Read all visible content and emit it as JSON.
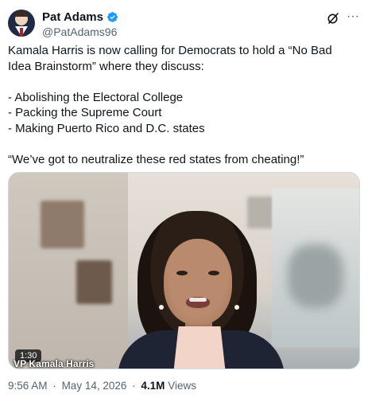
{
  "author": {
    "display_name": "Pat Adams",
    "handle": "@PatAdams96",
    "verified": true,
    "verified_color": "#1d9bf0"
  },
  "actions": {
    "grok_icon": "grok-slash-icon",
    "more_icon": "more-horizontal-icon",
    "more_glyph": "···"
  },
  "tweet": {
    "text": "Kamala Harris is now calling for Democrats to hold a “No Bad Idea Brainstorm” where they discuss:\n\n- Abolishing the Electoral College\n- Packing the Supreme Court\n- Making Puerto Rico and D.C. states\n\n“We’ve got to neutralize these red states from cheating!”"
  },
  "media": {
    "duration": "1:30",
    "caption": "VP Kamala Harris"
  },
  "meta": {
    "time": "9:56 AM",
    "date": "May 14, 2026",
    "views_count": "4.1M",
    "views_label": "Views",
    "separator": "·"
  }
}
